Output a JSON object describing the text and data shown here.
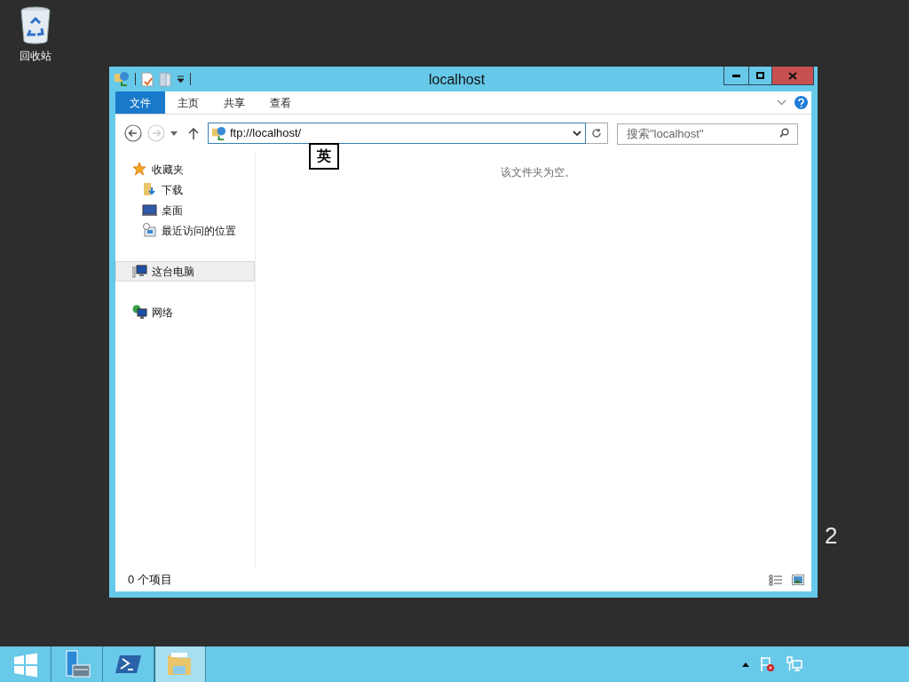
{
  "desktop": {
    "icons": [
      {
        "label": "回收站"
      }
    ],
    "edition_text": "2"
  },
  "window": {
    "title": "localhost"
  },
  "ribbon": {
    "tabs": [
      {
        "label": "文件",
        "kind": "file",
        "selected": false
      },
      {
        "label": "主页",
        "kind": "tab",
        "selected": false
      },
      {
        "label": "共享",
        "kind": "tab",
        "selected": false
      },
      {
        "label": "查看",
        "kind": "tab",
        "selected": false
      }
    ]
  },
  "address_bar": {
    "value": "ftp://localhost/"
  },
  "ime_indicator": "英",
  "search": {
    "placeholder": "搜索\"localhost\""
  },
  "navigation": {
    "items": [
      {
        "label": "收藏夹",
        "kind": "favorites",
        "selected": false,
        "children": [
          {
            "label": "下载",
            "kind": "downloads",
            "selected": false
          },
          {
            "label": "桌面",
            "kind": "desktop",
            "selected": false
          },
          {
            "label": "最近访问的位置",
            "kind": "recent",
            "selected": false
          }
        ]
      },
      {
        "label": "这台电脑",
        "kind": "computer",
        "selected": true
      },
      {
        "label": "网络",
        "kind": "network",
        "selected": false
      }
    ]
  },
  "empty_message": "该文件夹为空。",
  "status_bar": {
    "item_count": "0 个项目"
  },
  "taskbar": {
    "items": [
      {
        "kind": "start",
        "selected": false
      },
      {
        "kind": "servermanager",
        "selected": false
      },
      {
        "kind": "powershell",
        "selected": false
      },
      {
        "kind": "explorer",
        "selected": true
      }
    ]
  }
}
